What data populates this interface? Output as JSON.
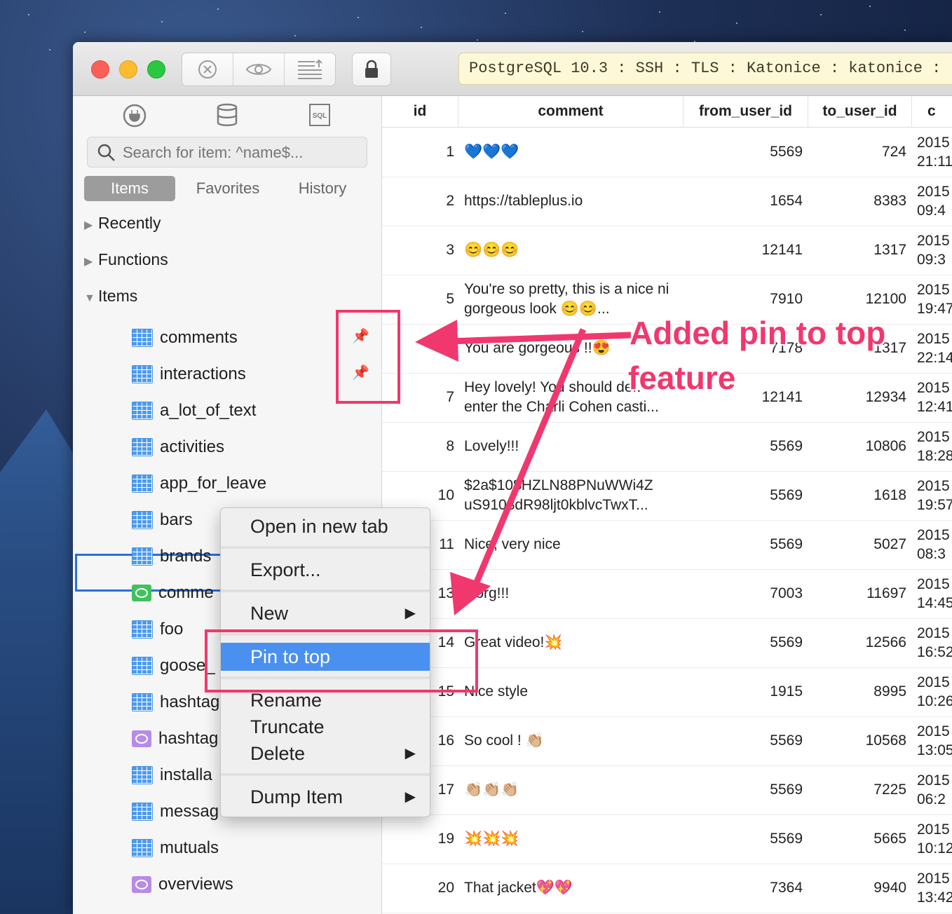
{
  "toolbar": {
    "connection": "PostgreSQL 10.3 : SSH : TLS : Katonice : katonice :"
  },
  "sidebar": {
    "search_placeholder": "Search for item: ^name$...",
    "tabs": [
      "Items",
      "Favorites",
      "History"
    ],
    "groups": [
      "Recently",
      "Functions",
      "Items"
    ],
    "items": [
      {
        "label": "comments",
        "type": "table",
        "pinned": true
      },
      {
        "label": "interactions",
        "type": "table",
        "pinned": true
      },
      {
        "label": "a_lot_of_text",
        "type": "table"
      },
      {
        "label": "activities",
        "type": "table"
      },
      {
        "label": "app_for_leave",
        "type": "table"
      },
      {
        "label": "bars",
        "type": "table",
        "selected": true
      },
      {
        "label": "brands",
        "type": "table"
      },
      {
        "label": "comme",
        "type": "view-green"
      },
      {
        "label": "foo",
        "type": "table"
      },
      {
        "label": "goose_",
        "type": "table"
      },
      {
        "label": "hashtag",
        "type": "table"
      },
      {
        "label": "hashtag",
        "type": "view-purple"
      },
      {
        "label": "installa",
        "type": "table"
      },
      {
        "label": "messag",
        "type": "table"
      },
      {
        "label": "mutuals",
        "type": "table"
      },
      {
        "label": "overviews",
        "type": "view-purple"
      }
    ]
  },
  "grid": {
    "columns": [
      "id",
      "comment",
      "from_user_id",
      "to_user_id",
      "c"
    ],
    "rows": [
      {
        "id": "1",
        "comment": "💙💙💙",
        "from": "5569",
        "to": "724",
        "date": "2015",
        "time": "21:11"
      },
      {
        "id": "2",
        "comment": "https://tableplus.io",
        "from": "1654",
        "to": "8383",
        "date": "2015",
        "time": "09:4"
      },
      {
        "id": "3",
        "comment": "😊😊😊",
        "from": "12141",
        "to": "1317",
        "date": "2015",
        "time": "09:3"
      },
      {
        "id": "5",
        "comment": "You're so pretty, this is a nice ni gorgeous look 😊😊...",
        "from": "7910",
        "to": "12100",
        "date": "2015",
        "time": "19:47"
      },
      {
        "id": "6",
        "comment": "You are gorgeous !!😍",
        "from": "7178",
        "to": "1317",
        "date": "2015",
        "time": "22:14"
      },
      {
        "id": "7",
        "comment": "Hey lovely! You should def. enter the Charli Cohen casti...",
        "from": "12141",
        "to": "12934",
        "date": "2015",
        "time": "12:41"
      },
      {
        "id": "8",
        "comment": "Lovely!!!",
        "from": "5569",
        "to": "10806",
        "date": "2015",
        "time": "18:28"
      },
      {
        "id": "10",
        "comment": "$2a$10$HZLN88PNuWWi4Z uS9108dR98ljt0kblvcTwxT...",
        "from": "5569",
        "to": "1618",
        "date": "2015",
        "time": "19:57"
      },
      {
        "id": "11",
        "comment": "Nice, very nice",
        "from": "5569",
        "to": "5027",
        "date": "2015",
        "time": "08:3"
      },
      {
        "id": "13",
        "comment": "Gorg!!!",
        "from": "7003",
        "to": "11697",
        "date": "2015",
        "time": "14:45"
      },
      {
        "id": "14",
        "comment": "Great video!💥",
        "from": "5569",
        "to": "12566",
        "date": "2015",
        "time": "16:52"
      },
      {
        "id": "15",
        "comment": "Nice style",
        "from": "1915",
        "to": "8995",
        "date": "2015",
        "time": "10:26"
      },
      {
        "id": "16",
        "comment": "So cool ! 👏🏼",
        "from": "5569",
        "to": "10568",
        "date": "2015",
        "time": "13:05"
      },
      {
        "id": "17",
        "comment": "👏🏼👏🏼👏🏼",
        "from": "5569",
        "to": "7225",
        "date": "2015",
        "time": "06:2"
      },
      {
        "id": "19",
        "comment": "💥💥💥",
        "from": "5569",
        "to": "5665",
        "date": "2015",
        "time": "10:12"
      },
      {
        "id": "20",
        "comment": "That jacket💖💖",
        "from": "7364",
        "to": "9940",
        "date": "2015",
        "time": "13:42"
      }
    ]
  },
  "context_menu": {
    "items": [
      "Open in new tab",
      "Export...",
      "New",
      "Pin to top",
      "Rename",
      "Truncate",
      "Delete",
      "Dump Item"
    ],
    "highlighted": "Pin to top"
  },
  "annotation": {
    "line1": "Added pin to top",
    "line2": "feature",
    "color": "#f0386e"
  },
  "colors": {
    "selection": "#2a6fdb",
    "menu_highlight": "#4a90f0",
    "table_icon": "#4c9bef",
    "view_green": "#3ec35a",
    "view_purple": "#b78be8"
  }
}
